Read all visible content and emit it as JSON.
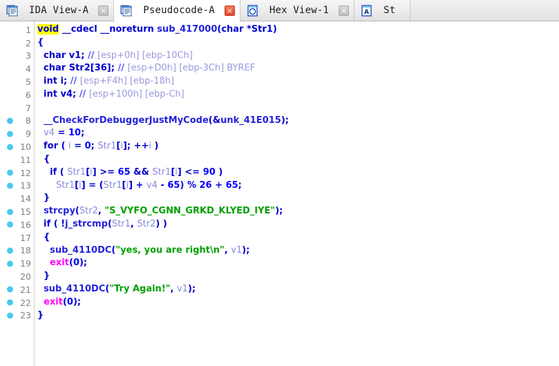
{
  "tabs": [
    {
      "label": "IDA View-A",
      "icon": "document-window-icon",
      "close_icon": "close-icon",
      "close_style": "grey",
      "active": false
    },
    {
      "label": "Pseudocode-A",
      "icon": "document-window-icon",
      "close_icon": "close-icon",
      "close_style": "red",
      "active": true
    },
    {
      "label": "Hex View-1",
      "icon": "hex-view-icon",
      "close_icon": "close-icon",
      "close_style": "grey",
      "active": false
    },
    {
      "label": "St",
      "icon": "structures-icon",
      "close_icon": "",
      "close_style": "none",
      "active": false
    }
  ],
  "close_glyph": "×",
  "editor": {
    "title": "Pseudocode-A",
    "lines": [
      {
        "n": 1,
        "breakpoint": false,
        "tokens": [
          {
            "t": "void",
            "c": "hl"
          },
          {
            "t": " ",
            "c": "plain"
          },
          {
            "t": "__cdecl __noreturn ",
            "c": "kw"
          },
          {
            "t": "sub_417000",
            "c": "fn"
          },
          {
            "t": "(",
            "c": "punc"
          },
          {
            "t": "char ",
            "c": "kw"
          },
          {
            "t": "*",
            "c": "punc"
          },
          {
            "t": "Str1",
            "c": "kw"
          },
          {
            "t": ")",
            "c": "punc"
          }
        ]
      },
      {
        "n": 2,
        "breakpoint": false,
        "tokens": [
          {
            "t": "{",
            "c": "punc"
          }
        ]
      },
      {
        "n": 3,
        "breakpoint": false,
        "tokens": [
          {
            "t": "  char ",
            "c": "kw"
          },
          {
            "t": "v1",
            "c": "kw"
          },
          {
            "t": "; ",
            "c": "punc"
          },
          {
            "t": "// ",
            "c": "cmt"
          },
          {
            "t": "[esp+0h] [ebp-10Ch]",
            "c": "cmt2"
          }
        ]
      },
      {
        "n": 4,
        "breakpoint": false,
        "tokens": [
          {
            "t": "  char ",
            "c": "kw"
          },
          {
            "t": "Str2[36]",
            "c": "kw"
          },
          {
            "t": "; ",
            "c": "punc"
          },
          {
            "t": "// ",
            "c": "cmt"
          },
          {
            "t": "[esp+D0h] [ebp-3Ch] BYREF",
            "c": "cmt2"
          }
        ]
      },
      {
        "n": 5,
        "breakpoint": false,
        "tokens": [
          {
            "t": "  int ",
            "c": "kw"
          },
          {
            "t": "i",
            "c": "kw"
          },
          {
            "t": "; ",
            "c": "punc"
          },
          {
            "t": "// ",
            "c": "cmt"
          },
          {
            "t": "[esp+F4h] [ebp-18h]",
            "c": "cmt2"
          }
        ]
      },
      {
        "n": 6,
        "breakpoint": false,
        "tokens": [
          {
            "t": "  int ",
            "c": "kw"
          },
          {
            "t": "v4",
            "c": "kw"
          },
          {
            "t": "; ",
            "c": "punc"
          },
          {
            "t": "// ",
            "c": "cmt"
          },
          {
            "t": "[esp+100h] [ebp-Ch]",
            "c": "cmt2"
          }
        ]
      },
      {
        "n": 7,
        "breakpoint": false,
        "tokens": []
      },
      {
        "n": 8,
        "breakpoint": true,
        "tokens": [
          {
            "t": "  ",
            "c": "plain"
          },
          {
            "t": "__CheckForDebuggerJustMyCode",
            "c": "fn"
          },
          {
            "t": "(&",
            "c": "punc"
          },
          {
            "t": "unk_41E015",
            "c": "fn"
          },
          {
            "t": ");",
            "c": "punc"
          }
        ]
      },
      {
        "n": 9,
        "breakpoint": true,
        "tokens": [
          {
            "t": "  ",
            "c": "plain"
          },
          {
            "t": "v4",
            "c": "var"
          },
          {
            "t": " = ",
            "c": "punc"
          },
          {
            "t": "10",
            "c": "num"
          },
          {
            "t": ";",
            "c": "punc"
          }
        ]
      },
      {
        "n": 10,
        "breakpoint": true,
        "tokens": [
          {
            "t": "  for ",
            "c": "kw"
          },
          {
            "t": "( ",
            "c": "punc"
          },
          {
            "t": "i",
            "c": "var"
          },
          {
            "t": " = ",
            "c": "punc"
          },
          {
            "t": "0",
            "c": "num"
          },
          {
            "t": "; ",
            "c": "punc"
          },
          {
            "t": "Str1",
            "c": "var"
          },
          {
            "t": "[",
            "c": "punc"
          },
          {
            "t": "i",
            "c": "var"
          },
          {
            "t": "]; ++",
            "c": "punc"
          },
          {
            "t": "i",
            "c": "var"
          },
          {
            "t": " )",
            "c": "punc"
          }
        ]
      },
      {
        "n": 11,
        "breakpoint": false,
        "tokens": [
          {
            "t": "  {",
            "c": "punc"
          }
        ]
      },
      {
        "n": 12,
        "breakpoint": true,
        "tokens": [
          {
            "t": "    if ",
            "c": "kw"
          },
          {
            "t": "( ",
            "c": "punc"
          },
          {
            "t": "Str1",
            "c": "var"
          },
          {
            "t": "[",
            "c": "punc"
          },
          {
            "t": "i",
            "c": "var"
          },
          {
            "t": "] >= ",
            "c": "punc"
          },
          {
            "t": "65",
            "c": "num"
          },
          {
            "t": " && ",
            "c": "punc"
          },
          {
            "t": "Str1",
            "c": "var"
          },
          {
            "t": "[",
            "c": "punc"
          },
          {
            "t": "i",
            "c": "var"
          },
          {
            "t": "] <= ",
            "c": "punc"
          },
          {
            "t": "90",
            "c": "num"
          },
          {
            "t": " )",
            "c": "punc"
          }
        ]
      },
      {
        "n": 13,
        "breakpoint": true,
        "tokens": [
          {
            "t": "      ",
            "c": "plain"
          },
          {
            "t": "Str1",
            "c": "var"
          },
          {
            "t": "[",
            "c": "punc"
          },
          {
            "t": "i",
            "c": "var"
          },
          {
            "t": "] = (",
            "c": "punc"
          },
          {
            "t": "Str1",
            "c": "var"
          },
          {
            "t": "[",
            "c": "punc"
          },
          {
            "t": "i",
            "c": "var"
          },
          {
            "t": "] + ",
            "c": "punc"
          },
          {
            "t": "v4",
            "c": "var"
          },
          {
            "t": " - ",
            "c": "punc"
          },
          {
            "t": "65",
            "c": "num"
          },
          {
            "t": ") % ",
            "c": "punc"
          },
          {
            "t": "26",
            "c": "num"
          },
          {
            "t": " + ",
            "c": "punc"
          },
          {
            "t": "65",
            "c": "num"
          },
          {
            "t": ";",
            "c": "punc"
          }
        ]
      },
      {
        "n": 14,
        "breakpoint": false,
        "tokens": [
          {
            "t": "  }",
            "c": "punc"
          }
        ]
      },
      {
        "n": 15,
        "breakpoint": true,
        "tokens": [
          {
            "t": "  ",
            "c": "plain"
          },
          {
            "t": "strcpy",
            "c": "fn"
          },
          {
            "t": "(",
            "c": "punc"
          },
          {
            "t": "Str2",
            "c": "var"
          },
          {
            "t": ", ",
            "c": "punc"
          },
          {
            "t": "\"S_VYFO_CGNN_GRKD_KLYED_IYE\"",
            "c": "str"
          },
          {
            "t": ");",
            "c": "punc"
          }
        ]
      },
      {
        "n": 16,
        "breakpoint": true,
        "tokens": [
          {
            "t": "  if ",
            "c": "kw"
          },
          {
            "t": "( !",
            "c": "punc"
          },
          {
            "t": "j_strcmp",
            "c": "fn"
          },
          {
            "t": "(",
            "c": "punc"
          },
          {
            "t": "Str1",
            "c": "var"
          },
          {
            "t": ", ",
            "c": "punc"
          },
          {
            "t": "Str2",
            "c": "var"
          },
          {
            "t": ") )",
            "c": "punc"
          }
        ]
      },
      {
        "n": 17,
        "breakpoint": false,
        "tokens": [
          {
            "t": "  {",
            "c": "punc"
          }
        ]
      },
      {
        "n": 18,
        "breakpoint": true,
        "tokens": [
          {
            "t": "    ",
            "c": "plain"
          },
          {
            "t": "sub_4110DC",
            "c": "fn"
          },
          {
            "t": "(",
            "c": "punc"
          },
          {
            "t": "\"yes, you are right\\n\"",
            "c": "str"
          },
          {
            "t": ", ",
            "c": "punc"
          },
          {
            "t": "v1",
            "c": "var"
          },
          {
            "t": ");",
            "c": "punc"
          }
        ]
      },
      {
        "n": 19,
        "breakpoint": true,
        "tokens": [
          {
            "t": "    ",
            "c": "plain"
          },
          {
            "t": "exit",
            "c": "lib"
          },
          {
            "t": "(",
            "c": "punc"
          },
          {
            "t": "0",
            "c": "num"
          },
          {
            "t": ");",
            "c": "punc"
          }
        ]
      },
      {
        "n": 20,
        "breakpoint": false,
        "tokens": [
          {
            "t": "  }",
            "c": "punc"
          }
        ]
      },
      {
        "n": 21,
        "breakpoint": true,
        "tokens": [
          {
            "t": "  ",
            "c": "plain"
          },
          {
            "t": "sub_4110DC",
            "c": "fn"
          },
          {
            "t": "(",
            "c": "punc"
          },
          {
            "t": "\"Try Again!\"",
            "c": "str"
          },
          {
            "t": ", ",
            "c": "punc"
          },
          {
            "t": "v1",
            "c": "var"
          },
          {
            "t": ");",
            "c": "punc"
          }
        ]
      },
      {
        "n": 22,
        "breakpoint": true,
        "tokens": [
          {
            "t": "  ",
            "c": "plain"
          },
          {
            "t": "exit",
            "c": "lib"
          },
          {
            "t": "(",
            "c": "punc"
          },
          {
            "t": "0",
            "c": "num"
          },
          {
            "t": ");",
            "c": "punc"
          }
        ]
      },
      {
        "n": 23,
        "breakpoint": true,
        "tokens": [
          {
            "t": "}",
            "c": "punc"
          }
        ]
      }
    ]
  },
  "colors": {
    "breakpoint": "#4bc8f0",
    "highlight": "#ffff00",
    "string": "#00a000",
    "library_function": "#ff00ff",
    "variable": "#8888dd",
    "comment": "#5555ff",
    "keyword": "#0000d0",
    "close_active": "#e04a28"
  }
}
